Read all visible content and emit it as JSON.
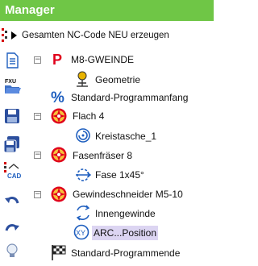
{
  "window": {
    "title": "Manager"
  },
  "toolbar": {
    "generate_label": "Gesamten NC-Code NEU erzeugen"
  },
  "sidebar": {
    "icons": [
      "file-list-icon",
      "fxu-open-icon",
      "save-icon",
      "save-as-icon",
      "cad-icon",
      "undo-icon",
      "redo-icon",
      "lamp-icon"
    ]
  },
  "tree": {
    "items": [
      {
        "label": "M8-GWEINDE",
        "icon": "program-p-icon",
        "expanded": true
      },
      {
        "label": "Geometrie",
        "icon": "geometry-icon"
      },
      {
        "label": "Standard-Programmanfang",
        "icon": "percent-icon"
      },
      {
        "label": "Flach 4",
        "icon": "tool-icon",
        "expanded": true
      },
      {
        "label": "Kreistasche_1",
        "icon": "circular-pocket-icon"
      },
      {
        "label": "Fasenfräser 8",
        "icon": "tool-icon",
        "expanded": true
      },
      {
        "label": "Fase 1x45°",
        "icon": "chamfer-icon"
      },
      {
        "label": "Gewindeschneider M5-10",
        "icon": "tool-icon",
        "expanded": true
      },
      {
        "label": "Innengewinde",
        "icon": "thread-icon"
      },
      {
        "label": "ARC...Position",
        "icon": "arc-position-icon",
        "selected": true
      },
      {
        "label": "Standard-Programmende",
        "icon": "checkered-flag-icon"
      }
    ],
    "expander_symbol": "−"
  },
  "colors": {
    "header": "#6fc646",
    "selection": "#dcd5f2",
    "accent_blue": "#1f5fbf",
    "accent_red": "#e0001b"
  }
}
